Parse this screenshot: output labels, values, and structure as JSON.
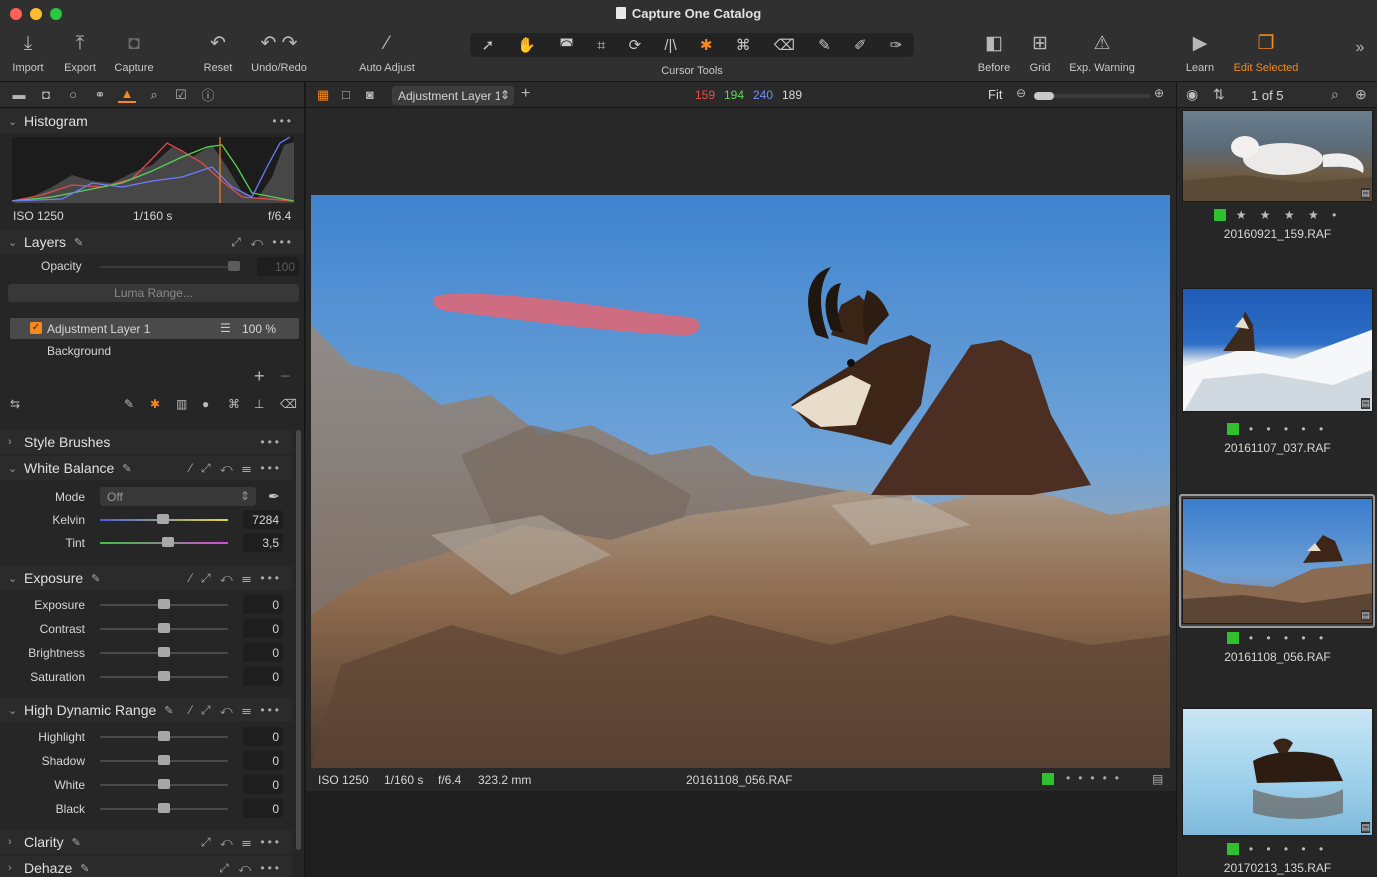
{
  "window": {
    "title": "Capture One Catalog"
  },
  "toolbar": {
    "import": {
      "label": "Import",
      "icon": "import-icon"
    },
    "export": {
      "label": "Export",
      "icon": "export-icon"
    },
    "capture": {
      "label": "Capture",
      "icon": "camera-icon"
    },
    "reset": {
      "label": "Reset",
      "icon": "reset-icon"
    },
    "undo_redo": {
      "label": "Undo/Redo",
      "icon": "undo-redo-icon"
    },
    "auto_adjust": {
      "label": "Auto Adjust",
      "icon": "magic-wand-icon"
    },
    "cursor_tools": {
      "label": "Cursor Tools"
    },
    "before": {
      "label": "Before",
      "icon": "before-after-icon"
    },
    "grid": {
      "label": "Grid",
      "icon": "grid-icon"
    },
    "exp_warning": {
      "label": "Exp. Warning",
      "icon": "warning-icon"
    },
    "learn": {
      "label": "Learn",
      "icon": "learn-icon"
    },
    "edit_selected": {
      "label": "Edit Selected",
      "icon": "edit-selected-icon"
    }
  },
  "histogram": {
    "title": "Histogram",
    "iso": "ISO 1250",
    "shutter": "1/160 s",
    "aperture": "f/6.4"
  },
  "layers": {
    "title": "Layers",
    "opacity_label": "Opacity",
    "opacity_value": "100",
    "luma_range": "Luma Range...",
    "items": [
      {
        "name": "Adjustment Layer 1",
        "opacity": "100 %",
        "checked": true
      },
      {
        "name": "Background"
      }
    ]
  },
  "style_brushes": {
    "title": "Style Brushes"
  },
  "white_balance": {
    "title": "White Balance",
    "mode_label": "Mode",
    "mode_value": "Off",
    "kelvin_label": "Kelvin",
    "kelvin_value": "7284",
    "tint_label": "Tint",
    "tint_value": "3,5"
  },
  "exposure": {
    "title": "Exposure",
    "rows": [
      {
        "label": "Exposure",
        "value": "0"
      },
      {
        "label": "Contrast",
        "value": "0"
      },
      {
        "label": "Brightness",
        "value": "0"
      },
      {
        "label": "Saturation",
        "value": "0"
      }
    ]
  },
  "hdr": {
    "title": "High Dynamic Range",
    "rows": [
      {
        "label": "Highlight",
        "value": "0"
      },
      {
        "label": "Shadow",
        "value": "0"
      },
      {
        "label": "White",
        "value": "0"
      },
      {
        "label": "Black",
        "value": "0"
      }
    ]
  },
  "clarity": {
    "title": "Clarity"
  },
  "dehaze": {
    "title": "Dehaze"
  },
  "viewer_bar": {
    "layer_select": "Adjustment Layer 1",
    "rgb": {
      "r": "159",
      "g": "194",
      "b": "240",
      "l": "189"
    },
    "zoom": "Fit"
  },
  "viewer_footer": {
    "iso": "ISO 1250",
    "shutter": "1/160 s",
    "aperture": "f/6.4",
    "focal": "323.2 mm",
    "filename": "20161108_056.RAF"
  },
  "browser": {
    "count": "1 of 5",
    "items": [
      {
        "filename": "20160921_159.RAF",
        "stars": "★ ★ ★ ★ •"
      },
      {
        "filename": "20161107_037.RAF",
        "stars": "• • • • •"
      },
      {
        "filename": "20161108_056.RAF",
        "stars": "• • • • •"
      },
      {
        "filename": "20170213_135.RAF",
        "stars": "• • • • •"
      }
    ]
  },
  "colors": {
    "accent": "#f5891e",
    "green_tag": "#2ec02e",
    "r": "#ef4b4b",
    "g": "#61d861",
    "b": "#6d8dff"
  }
}
